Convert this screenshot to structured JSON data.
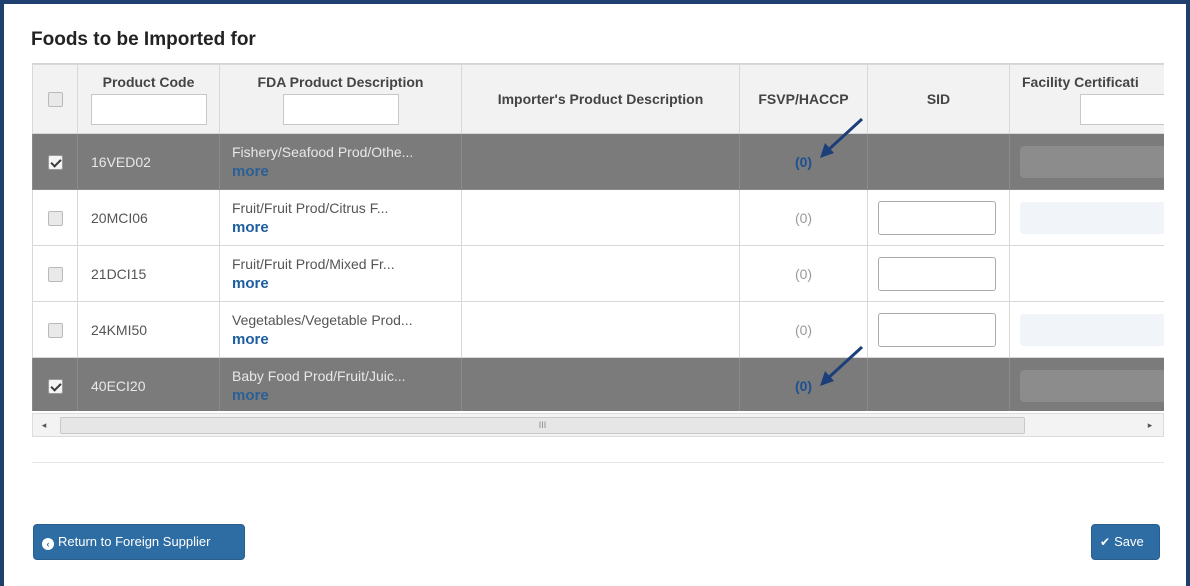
{
  "section": {
    "title": "Foods to be Imported for"
  },
  "columns": {
    "product_code": "Product Code",
    "fda_description": "FDA Product Description",
    "importer_description": "Importer's Product Description",
    "fsvp_haccp": "FSVP/HACCP",
    "sid": "SID",
    "facility_cert": "Facility Certificati"
  },
  "rows": [
    {
      "code": "16VED02",
      "desc": "Fishery/Seafood Prod/Othe...",
      "more": "more",
      "count": "(0)",
      "selected": true
    },
    {
      "code": "20MCI06",
      "desc": "Fruit/Fruit Prod/Citrus F...",
      "more": "more",
      "count": "(0)",
      "selected": false
    },
    {
      "code": "21DCI15",
      "desc": "Fruit/Fruit Prod/Mixed Fr...",
      "more": "more",
      "count": "(0)",
      "selected": false
    },
    {
      "code": "24KMI50",
      "desc": "Vegetables/Vegetable Prod...",
      "more": "more",
      "count": "(0)",
      "selected": false
    },
    {
      "code": "40ECI20",
      "desc": "Baby Food Prod/Fruit/Juic...",
      "more": "more",
      "count": "(0)",
      "selected": true
    }
  ],
  "scrollbar": {
    "grip": "III",
    "left_arrow": "◂",
    "right_arrow": "▸"
  },
  "buttons": {
    "return_label": "Return to Foreign Supplier",
    "save_label": "Save"
  },
  "colors": {
    "primary_button": "#2e6da4",
    "selected_row": "#7b7b7b",
    "link": "#1c5e9e",
    "frame": "#1f3f6e"
  },
  "icons": {
    "return": "circle-left-arrow-icon",
    "save": "save-check-icon",
    "annotation": "pointer-arrow-icon"
  }
}
